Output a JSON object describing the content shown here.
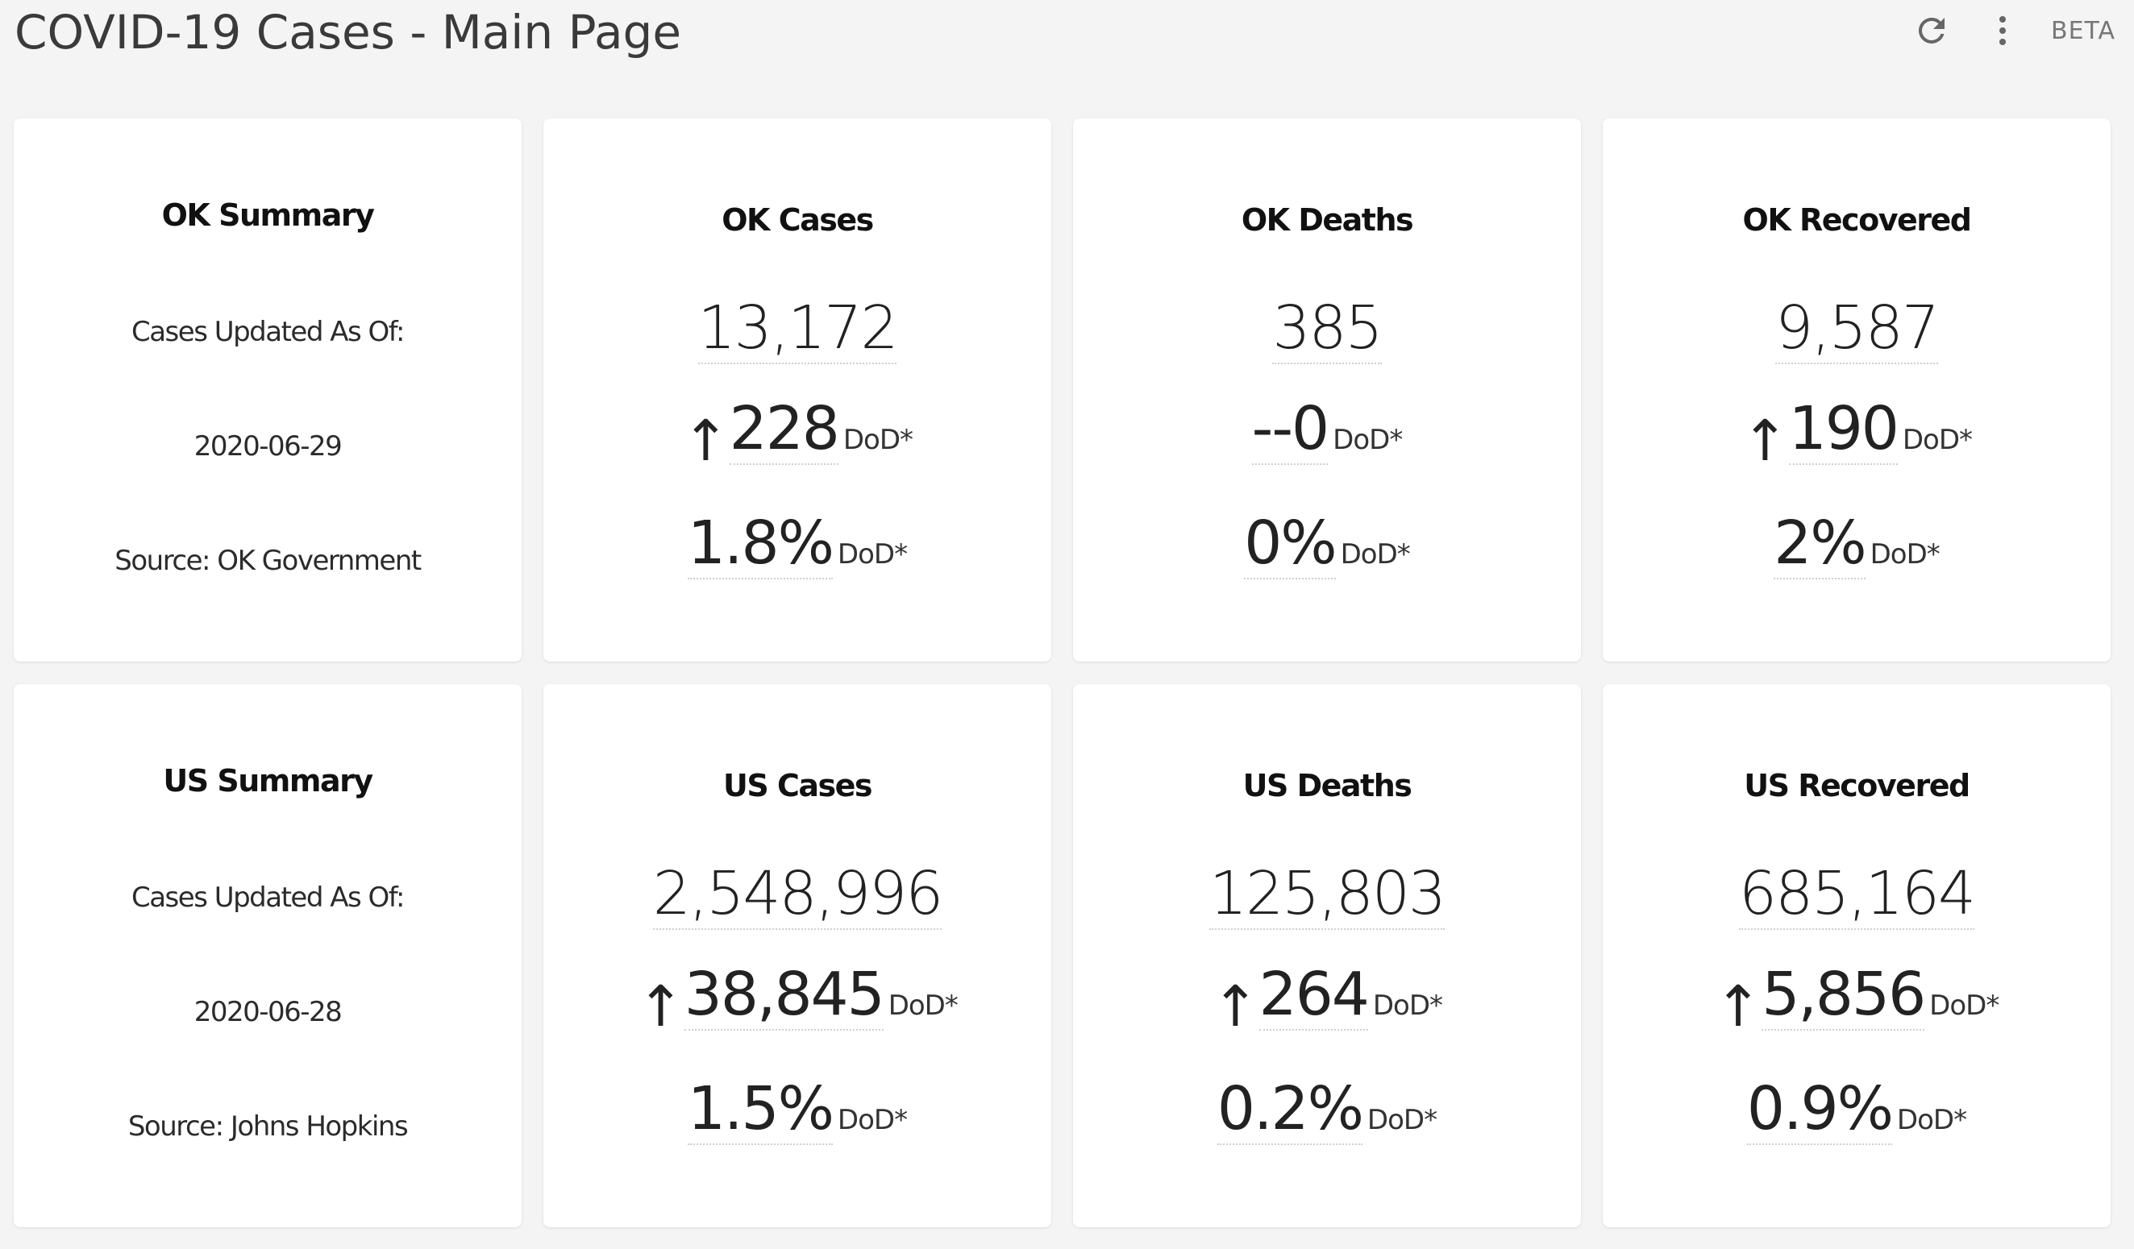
{
  "header": {
    "title": "COVID-19 Cases - Main Page",
    "refresh_icon": "refresh-icon",
    "more_icon": "more-vertical-icon",
    "beta_label": "BETA"
  },
  "unit_label": "DoD*",
  "ok": {
    "summary": {
      "title": "OK Summary",
      "updated_label": "Cases Updated As Of:",
      "date": "2020-06-29",
      "source": "Source: OK Government"
    },
    "cases": {
      "title": "OK Cases",
      "total": "13,172",
      "arrow": "↑",
      "delta": "228",
      "pct": "1.8%"
    },
    "deaths": {
      "title": "OK Deaths",
      "total": "385",
      "arrow": "",
      "delta": "--0",
      "pct": "0%"
    },
    "recovered": {
      "title": "OK Recovered",
      "total": "9,587",
      "arrow": "↑",
      "delta": "190",
      "pct": "2%"
    }
  },
  "us": {
    "summary": {
      "title": "US Summary",
      "updated_label": "Cases Updated As Of:",
      "date": "2020-06-28",
      "source": "Source: Johns Hopkins"
    },
    "cases": {
      "title": "US Cases",
      "total": "2,548,996",
      "arrow": "↑",
      "delta": "38,845",
      "pct": "1.5%"
    },
    "deaths": {
      "title": "US Deaths",
      "total": "125,803",
      "arrow": "↑",
      "delta": "264",
      "pct": "0.2%"
    },
    "recovered": {
      "title": "US Recovered",
      "total": "685,164",
      "arrow": "↑",
      "delta": "5,856",
      "pct": "0.9%"
    }
  },
  "colors": {
    "background": "#f4f4f5",
    "card": "#ffffff",
    "text": "#222222",
    "muted": "#777777"
  }
}
